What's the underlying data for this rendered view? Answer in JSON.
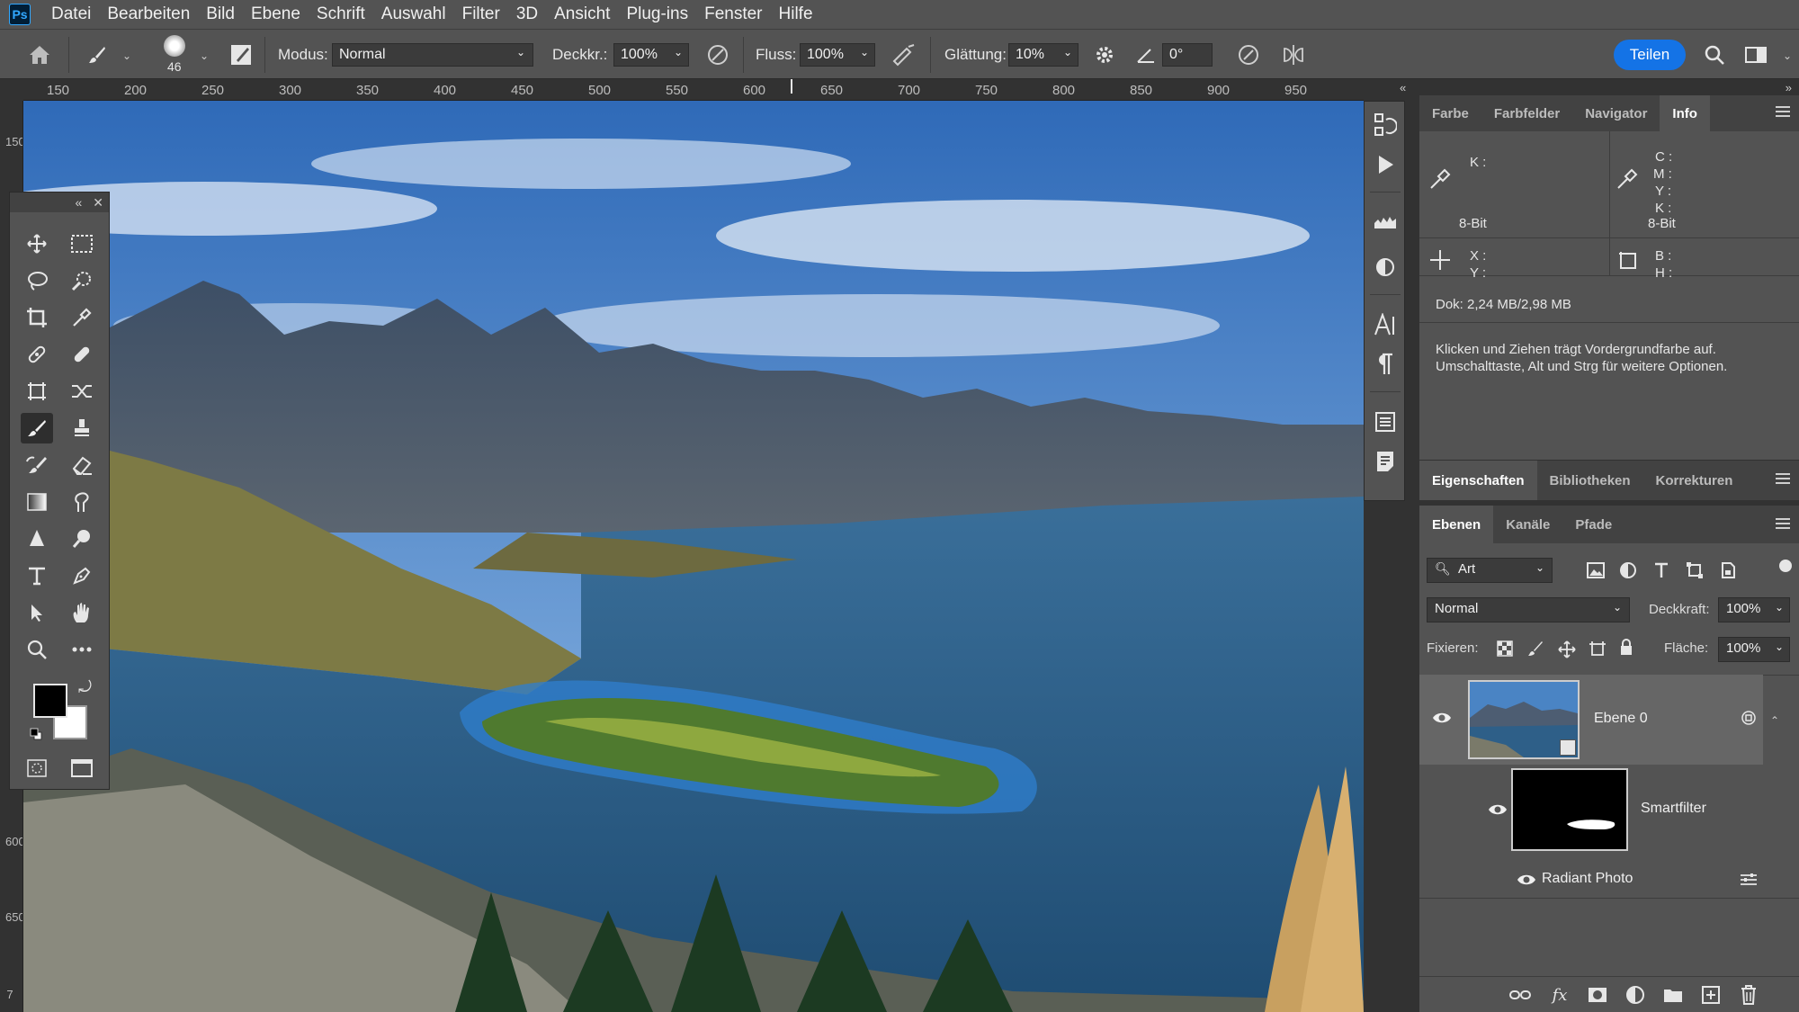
{
  "app": {
    "logo": "Ps"
  },
  "menu": [
    "Datei",
    "Bearbeiten",
    "Bild",
    "Ebene",
    "Schrift",
    "Auswahl",
    "Filter",
    "3D",
    "Ansicht",
    "Plug-ins",
    "Fenster",
    "Hilfe"
  ],
  "options": {
    "brush_size": "46",
    "mode_label": "Modus:",
    "mode_value": "Normal",
    "opacity_label": "Deckkr.:",
    "opacity_value": "100%",
    "flow_label": "Fluss:",
    "flow_value": "100%",
    "smoothing_label": "Glättung:",
    "smoothing_value": "10%",
    "angle_value": "0°",
    "share_label": "Teilen"
  },
  "ruler": {
    "horizontal": [
      "150",
      "200",
      "250",
      "300",
      "350",
      "400",
      "450",
      "500",
      "550",
      "600",
      "650",
      "700",
      "750",
      "800",
      "850",
      "900",
      "950"
    ],
    "vertical": [
      "150",
      "600",
      "650",
      "7"
    ]
  },
  "info_panel": {
    "tabs": [
      "Farbe",
      "Farbfelder",
      "Navigator",
      "Info"
    ],
    "active_tab": "Info",
    "left_k": "K :",
    "left_bits": "8-Bit",
    "right_c": "C :",
    "right_m": "M :",
    "right_y": "Y :",
    "right_k": "K :",
    "right_bits": "8-Bit",
    "x_label": "X :",
    "y_label": "Y :",
    "b_label": "B :",
    "h_label": "H :",
    "doc": "Dok: 2,24 MB/2,98 MB",
    "hint_line1": "Klicken und Ziehen trägt Vordergrundfarbe auf.",
    "hint_line2": "Umschalttaste, Alt und Strg für weitere Optionen."
  },
  "props_panel": {
    "tabs": [
      "Eigenschaften",
      "Bibliotheken",
      "Korrekturen"
    ],
    "active_tab": "Eigenschaften"
  },
  "layers_panel": {
    "tabs": [
      "Ebenen",
      "Kanäle",
      "Pfade"
    ],
    "active_tab": "Ebenen",
    "filter_label": "Art",
    "blend_mode": "Normal",
    "opacity_label": "Deckkraft:",
    "opacity_value": "100%",
    "lock_label": "Fixieren:",
    "fill_label": "Fläche:",
    "fill_value": "100%",
    "layers": [
      {
        "name": "Ebene 0"
      },
      {
        "name": "Smartfilter"
      },
      {
        "name": "Radiant Photo"
      }
    ]
  },
  "colors": {
    "accent": "#1473e6",
    "panel_bg": "#535353",
    "dark_bg": "#323232",
    "foreground": "#000000",
    "background": "#ffffff"
  }
}
